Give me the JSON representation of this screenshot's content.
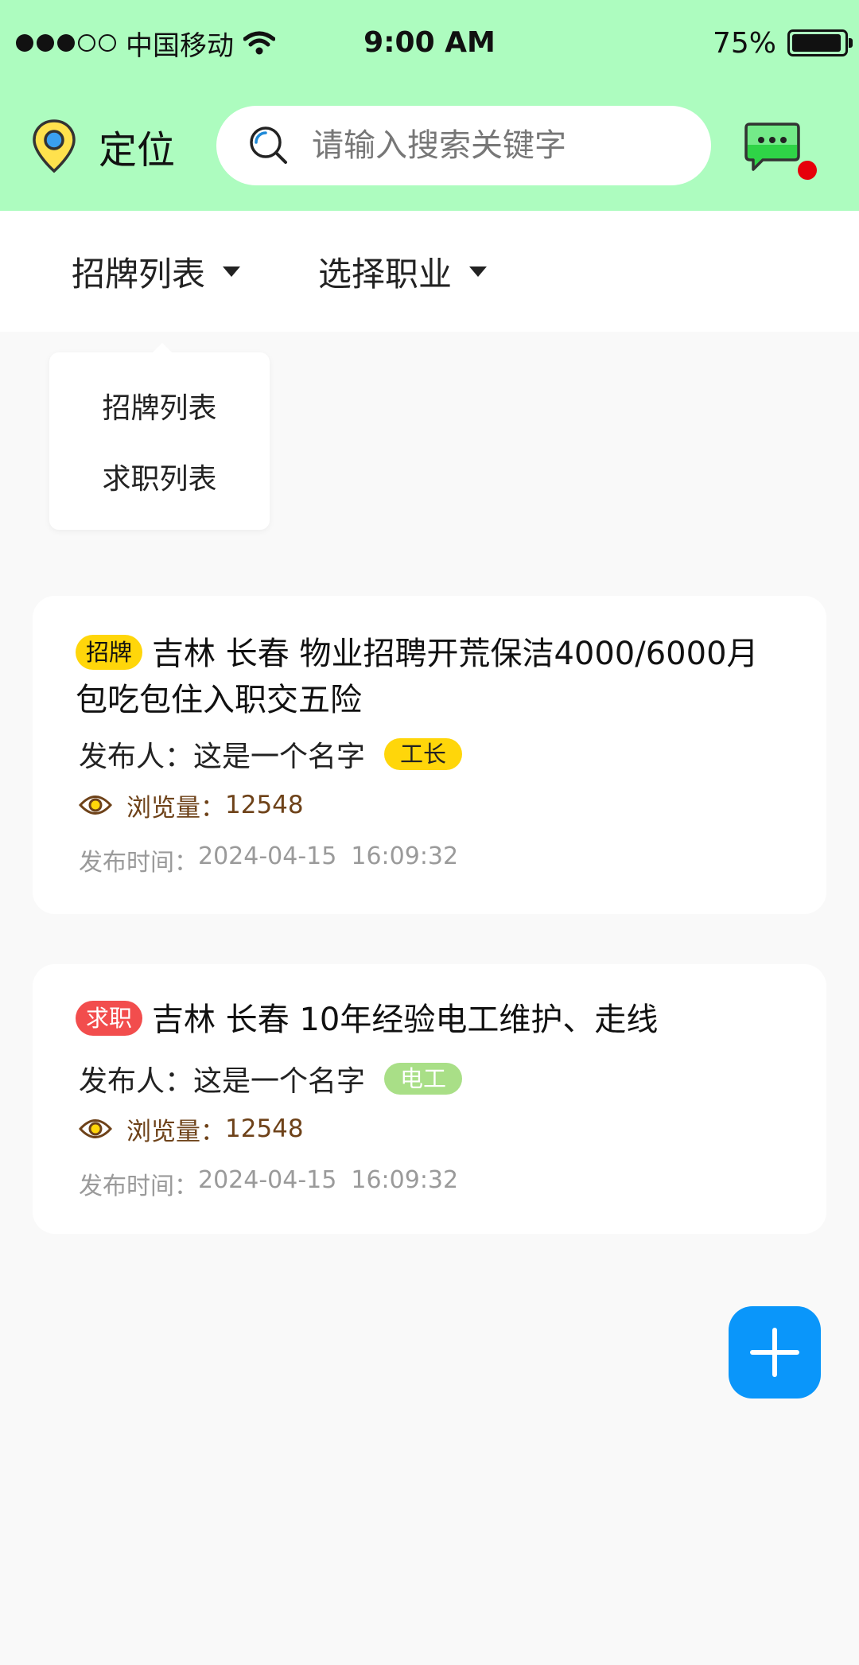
{
  "status_bar": {
    "carrier": "中国移动",
    "time": "9:00 AM",
    "battery_text": "75%",
    "battery_level": 0.95,
    "signal_bars_filled": 3,
    "signal_bars_total": 5,
    "icons": [
      "signal-dots-icon",
      "wifi-icon",
      "battery-icon"
    ]
  },
  "header": {
    "location_label": "定位",
    "search_placeholder": "请输入搜索关键字",
    "has_unread_messages": true,
    "colors": {
      "background": "#adfcbf",
      "pin": "#ffe14d",
      "pin_center": "#3aa0f0",
      "chat": "#2fd447",
      "unread": "#e6000a"
    }
  },
  "filters": {
    "list_type": "招牌列表",
    "profession": "选择职业"
  },
  "dropdown": {
    "items": [
      "招牌列表",
      "求职列表"
    ]
  },
  "posts": [
    {
      "tag": "招牌",
      "title": "吉林 长春 物业招聘开荒保洁4000/6000月包吃包住入职交五险",
      "publisher_label": "发布人：",
      "publisher": "这是一个名字",
      "job": "工长",
      "views_label": "浏览量：",
      "views": "12548",
      "time_label": "发布时间：",
      "date": "2024-04-15",
      "time": "16:09:32"
    },
    {
      "tag": "求职",
      "title": "吉林 长春 10年经验电工维护、走线",
      "publisher_label": "发布人：",
      "publisher": "这是一个名字",
      "job": "电工",
      "views_label": "浏览量：",
      "views": "12548",
      "time_label": "发布时间：",
      "date": "2024-04-15",
      "time": "16:09:32"
    }
  ],
  "fab": {
    "icon": "plus-icon",
    "color": "#0a96fa"
  }
}
